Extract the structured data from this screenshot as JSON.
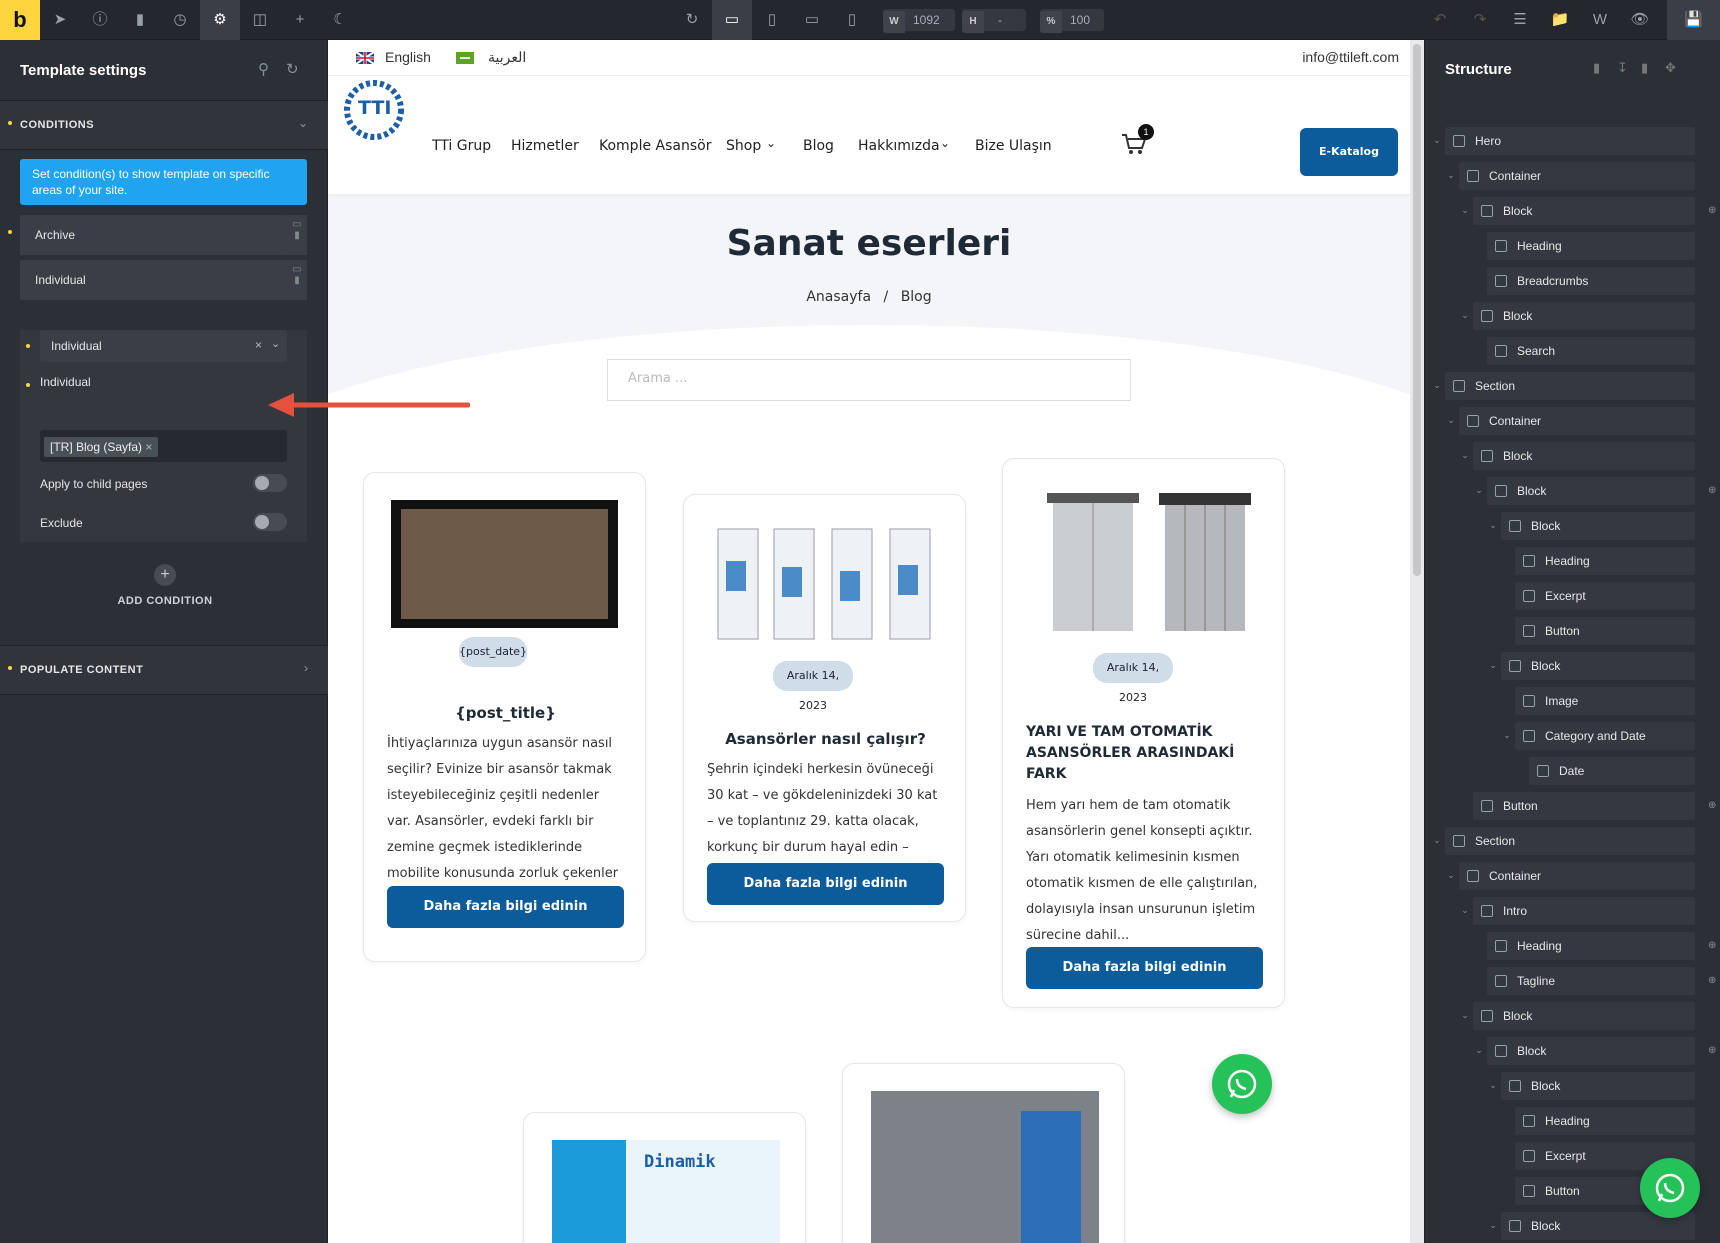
{
  "toolbar": {
    "logo": "b",
    "width_label": "W",
    "width_value": "1092",
    "height_label": "H",
    "height_value": "-",
    "zoom_label": "%",
    "zoom_value": "100"
  },
  "left_panel": {
    "title": "Template settings",
    "conditions_header": "CONDITIONS",
    "info": "Set condition(s) to show template on specific areas of your site.",
    "rows": [
      "Archive",
      "Individual"
    ],
    "select_value": "Individual",
    "individual_label": "Individual",
    "tag": "[TR] Blog (Sayfa)",
    "apply_child": "Apply to child pages",
    "exclude": "Exclude",
    "add_condition": "ADD CONDITION",
    "populate": "POPULATE CONTENT"
  },
  "site": {
    "lang_en": "English",
    "lang_ar": "العربية",
    "email": "info@ttileft.com",
    "logo_text": "TTI",
    "nav": [
      "TTi Grup",
      "Hizmetler",
      "Komple Asansör",
      "Shop",
      "Blog",
      "Hakkımızda",
      "Bize Ulaşın"
    ],
    "cart_count": "1",
    "catalog_btn": "E-Katalog",
    "page_title": "Sanat eserleri",
    "breadcrumb_home": "Anasayfa",
    "breadcrumb_sep": "/",
    "breadcrumb_current": "Blog",
    "search_placeholder": "Arama ...",
    "posts": [
      {
        "date": "{post_date}",
        "title": "{post_title}",
        "excerpt": "İhtiyaçlarınıza uygun asansör nasıl seçilir? Evinize bir asansör takmak isteyebileceğiniz çeşitli nedenler var. Asansörler, evdeki farklı bir zemine geçmek istediklerinde mobilite konusunda zorluk çekenler için...",
        "button": "Daha fazla bilgi edinin"
      },
      {
        "date": "Aralık 14, 2023",
        "title": "Asansörler nasıl çalışır?",
        "excerpt": "Şehrin içindeki herkesin övüneceği 30 kat – ve gökdeleninizdeki 30 kat – ve toplantınız 29. katta olacak, korkunç bir durum hayal edin – tamam, işte...",
        "button": "Daha fazla bilgi edinin"
      },
      {
        "date": "Aralık 14, 2023",
        "title": "YARI VE TAM OTOMATİK ASANSÖRLER ARASINDAKİ FARK",
        "excerpt": "Hem yarı hem de tam otomatik asansörlerin genel konsepti açıktır. Yarı otomatik kelimesinin kısmen otomatik kısmen de elle çalıştırılan, dolayısıyla insan unsurunun işletim sürecine dahil...",
        "button": "Daha fazla bilgi edinin"
      }
    ],
    "dinamik_label": "Dinamik"
  },
  "structure": {
    "title": "Structure",
    "items": [
      {
        "label": "Hero",
        "icon": "section"
      },
      {
        "label": "Container",
        "icon": "box"
      },
      {
        "label": "Block",
        "icon": "box"
      },
      {
        "label": "Heading",
        "icon": "heading"
      },
      {
        "label": "Breadcrumbs",
        "icon": "breadcrumb"
      },
      {
        "label": "Block",
        "icon": "box"
      },
      {
        "label": "Search",
        "icon": "search"
      },
      {
        "label": "Section",
        "icon": "section"
      },
      {
        "label": "Container",
        "icon": "box"
      },
      {
        "label": "Block",
        "icon": "box"
      },
      {
        "label": "Block",
        "icon": "box"
      },
      {
        "label": "Block",
        "icon": "box"
      },
      {
        "label": "Heading",
        "icon": "heading"
      },
      {
        "label": "Excerpt",
        "icon": "paragraph"
      },
      {
        "label": "Button",
        "icon": "button"
      },
      {
        "label": "Block",
        "icon": "box"
      },
      {
        "label": "Image",
        "icon": "image"
      },
      {
        "label": "Category and Date",
        "icon": "box"
      },
      {
        "label": "Date",
        "icon": "list"
      },
      {
        "label": "Button",
        "icon": "button"
      },
      {
        "label": "Section",
        "icon": "section"
      },
      {
        "label": "Container",
        "icon": "box"
      },
      {
        "label": "Intro",
        "icon": "box"
      },
      {
        "label": "Heading",
        "icon": "heading"
      },
      {
        "label": "Tagline",
        "icon": "list"
      },
      {
        "label": "Block",
        "icon": "box"
      },
      {
        "label": "Block",
        "icon": "box"
      },
      {
        "label": "Block",
        "icon": "box"
      },
      {
        "label": "Heading",
        "icon": "heading"
      },
      {
        "label": "Excerpt",
        "icon": "paragraph"
      },
      {
        "label": "Button",
        "icon": "button"
      },
      {
        "label": "Block",
        "icon": "box"
      }
    ]
  }
}
